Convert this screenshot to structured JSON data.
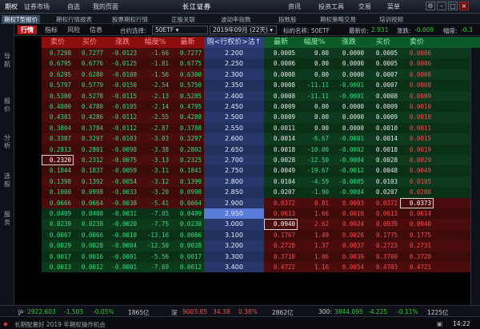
{
  "topmenu": {
    "items": [
      "期权",
      "证券市场",
      "自选",
      "我的页面",
      "资讯",
      "投资工具",
      "交易",
      "菜单"
    ],
    "brand": "长江证券"
  },
  "submenu": {
    "items": [
      "期权T型报价",
      "期权行情报表",
      "股票期权行情",
      "正股关联",
      "波动率指数",
      "指数股",
      "期权策略交易",
      "培训视频"
    ]
  },
  "sidebar": [
    "导航",
    "报价",
    "分析",
    "选股",
    "服务"
  ],
  "optbar": {
    "tabs": [
      "行情",
      "指标",
      "风险",
      "信息"
    ],
    "contract_label": "合约选择:",
    "contract_value": "50ETF",
    "month_value": "2019年09月 (22天)",
    "underlying_label": "标的名称: 50ETF",
    "price_label": "最新价:",
    "price_value": "2.931",
    "change_label": "涨跌:",
    "change_value": "-0.009",
    "amp_label": "幅度:",
    "amp_value": "-0.3"
  },
  "headers": {
    "call": [
      "卖价",
      "买价",
      "涨跌",
      "幅度%",
      "最新"
    ],
    "mid": "购<行权价>沽↑",
    "put": [
      "最新",
      "幅度%",
      "涨跌",
      "买价",
      "卖价"
    ]
  },
  "rows": [
    {
      "c": [
        "0.7298",
        "0.7277",
        "-0.0123",
        "-1.66",
        "0.7277"
      ],
      "k": "2.200",
      "p": [
        "0.0005",
        "0.00",
        "0.0000",
        "0.0005",
        "0.0006"
      ]
    },
    {
      "c": [
        "0.6795",
        "0.6776",
        "-0.0125",
        "-1.81",
        "0.6775"
      ],
      "k": "2.250",
      "p": [
        "0.0006",
        "0.00",
        "0.0000",
        "0.0005",
        "0.0006"
      ]
    },
    {
      "c": [
        "0.6295",
        "0.6280",
        "-0.0100",
        "-1.56",
        "0.6300"
      ],
      "k": "2.300",
      "p": [
        "0.0008",
        "0.00",
        "0.0000",
        "0.0007",
        "0.0008"
      ]
    },
    {
      "c": [
        "0.5797",
        "0.5779",
        "-0.0150",
        "-2.54",
        "0.5750"
      ],
      "k": "2.350",
      "p": [
        "0.0008",
        "-11.11",
        "-0.0001",
        "0.0007",
        "0.0008"
      ]
    },
    {
      "c": [
        "0.5300",
        "0.5278",
        "-0.0115",
        "-2.13",
        "0.5285"
      ],
      "k": "2.400",
      "p": [
        "0.0008",
        "-11.11",
        "-0.0001",
        "0.0008",
        "0.0009"
      ]
    },
    {
      "c": [
        "0.4800",
        "0.4780",
        "-0.0105",
        "-2.14",
        "0.4795"
      ],
      "k": "2.450",
      "p": [
        "0.0009",
        "0.00",
        "0.0000",
        "0.0009",
        "0.0010"
      ]
    },
    {
      "c": [
        "0.4301",
        "0.4286",
        "-0.0112",
        "-2.55",
        "0.4288"
      ],
      "k": "2.500",
      "p": [
        "0.0009",
        "0.00",
        "0.0000",
        "0.0009",
        "0.0010"
      ]
    },
    {
      "c": [
        "0.3804",
        "0.3784",
        "-0.0112",
        "-2.87",
        "0.3788"
      ],
      "k": "2.550",
      "p": [
        "0.0011",
        "0.00",
        "0.0000",
        "0.0010",
        "0.0011"
      ]
    },
    {
      "c": [
        "0.3307",
        "0.3297",
        "-0.0103",
        "-3.03",
        "0.3297"
      ],
      "k": "2.600",
      "p": [
        "0.0014",
        "-6.67",
        "-0.0001",
        "0.0014",
        "0.0015"
      ]
    },
    {
      "c": [
        "0.2813",
        "0.2801",
        "-0.0098",
        "-3.38",
        "0.2802"
      ],
      "k": "2.650",
      "p": [
        "0.0018",
        "-10.00",
        "-0.0002",
        "0.0018",
        "0.0019"
      ]
    },
    {
      "c": [
        "0.2320",
        "0.2312",
        "-0.0075",
        "-3.13",
        "0.2325"
      ],
      "k": "2.700",
      "p": [
        "0.0028",
        "-12.50",
        "-0.0004",
        "0.0028",
        "0.0029"
      ]
    },
    {
      "c": [
        "0.1844",
        "0.1837",
        "-0.0059",
        "-3.11",
        "0.1841"
      ],
      "k": "2.750",
      "p": [
        "0.0049",
        "-19.67",
        "-0.0012",
        "0.0048",
        "0.0049"
      ]
    },
    {
      "c": [
        "0.1398",
        "0.1392",
        "-0.0054",
        "-3.12",
        "0.1399"
      ],
      "k": "2.800",
      "p": [
        "0.0104",
        "-4.59",
        "-0.0005",
        "0.0103",
        "0.0105"
      ]
    },
    {
      "c": [
        "0.1000",
        "0.0998",
        "-0.0033",
        "-3.20",
        "0.0998"
      ],
      "k": "2.850",
      "p": [
        "0.0207",
        "-1.90",
        "-0.0004",
        "0.0207",
        "0.0208"
      ]
    },
    {
      "c": [
        "0.0666",
        "0.0664",
        "-0.0038",
        "-5.41",
        "0.0664"
      ],
      "k": "2.900",
      "p": [
        "0.0372",
        "0.81",
        "0.0003",
        "0.0372",
        "0.0373"
      ]
    },
    {
      "c": [
        "0.0409",
        "0.0408",
        "-0.0031",
        "-7.05",
        "0.0409"
      ],
      "k": "2.950",
      "p": [
        "0.0613",
        "1.66",
        "0.0010",
        "0.0613",
        "0.0614"
      ]
    },
    {
      "c": [
        "0.0239",
        "0.0238",
        "-0.0020",
        "-7.75",
        "0.0238"
      ],
      "k": "3.000",
      "p": [
        "0.0940",
        "2.62",
        "0.0024",
        "0.0939",
        "0.0940"
      ]
    },
    {
      "c": [
        "0.0067",
        "0.0066",
        "-0.0010",
        "-13.16",
        "0.0066"
      ],
      "k": "3.100",
      "p": [
        "0.1767",
        "1.49",
        "0.0026",
        "0.1775",
        "0.1775"
      ]
    },
    {
      "c": [
        "0.0029",
        "0.0028",
        "-0.0004",
        "-12.50",
        "0.0028"
      ],
      "k": "3.200",
      "p": [
        "0.2728",
        "1.37",
        "0.0037",
        "0.2723",
        "0.2731"
      ]
    },
    {
      "c": [
        "0.0017",
        "0.0016",
        "-0.0001",
        "-5.56",
        "0.0017"
      ],
      "k": "3.300",
      "p": [
        "0.3710",
        "1.06",
        "0.0039",
        "0.3700",
        "0.3720"
      ]
    },
    {
      "c": [
        "0.0013",
        "0.0012",
        "-0.0001",
        "-7.69",
        "0.0012"
      ],
      "k": "3.400",
      "p": [
        "0.4722",
        "1.16",
        "0.0054",
        "0.4703",
        "0.4721"
      ]
    }
  ],
  "status": {
    "sh_label": "沪",
    "sh_value": "2922.603",
    "sh_change": "-1.503",
    "sh_pct": "-0.05%",
    "sh_amount": "1865亿",
    "sz_label": "深",
    "sz_value": "9003.85",
    "sz_change": "34.38",
    "sz_pct": "0.38%",
    "sz_amount": "2862亿",
    "cy_label": "300:",
    "cy_value": "3844.095",
    "cy_change": "-4.225",
    "cy_pct": "-0.11%",
    "cy_amount": "1225亿"
  },
  "bottom": {
    "ticker": "长期配置好 2019 年期权操作机会",
    "time": "14:22"
  }
}
